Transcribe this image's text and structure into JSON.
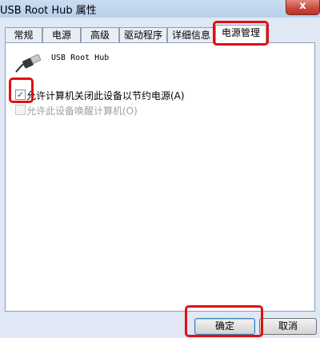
{
  "window": {
    "title": "USB Root Hub 属性",
    "close_glyph": "x"
  },
  "tabs": [
    {
      "label": "常规",
      "active": false
    },
    {
      "label": "电源",
      "active": false
    },
    {
      "label": "高级",
      "active": false
    },
    {
      "label": "驱动程序",
      "active": false
    },
    {
      "label": "详细信息",
      "active": false
    },
    {
      "label": "电源管理",
      "active": true
    }
  ],
  "device": {
    "name": "USB Root Hub",
    "icon": "usb-plug-icon"
  },
  "options": [
    {
      "label": "允许计算机关闭此设备以节约电源(A)",
      "checked": true,
      "enabled": true
    },
    {
      "label": "允许此设备唤醒计算机(O)",
      "checked": false,
      "enabled": false
    }
  ],
  "buttons": {
    "ok": "确定",
    "cancel": "取消"
  },
  "check_glyph": "✓",
  "colors": {
    "highlight": "#e01010",
    "titlebar": "#c9dcf2",
    "close": "#c8473a"
  }
}
